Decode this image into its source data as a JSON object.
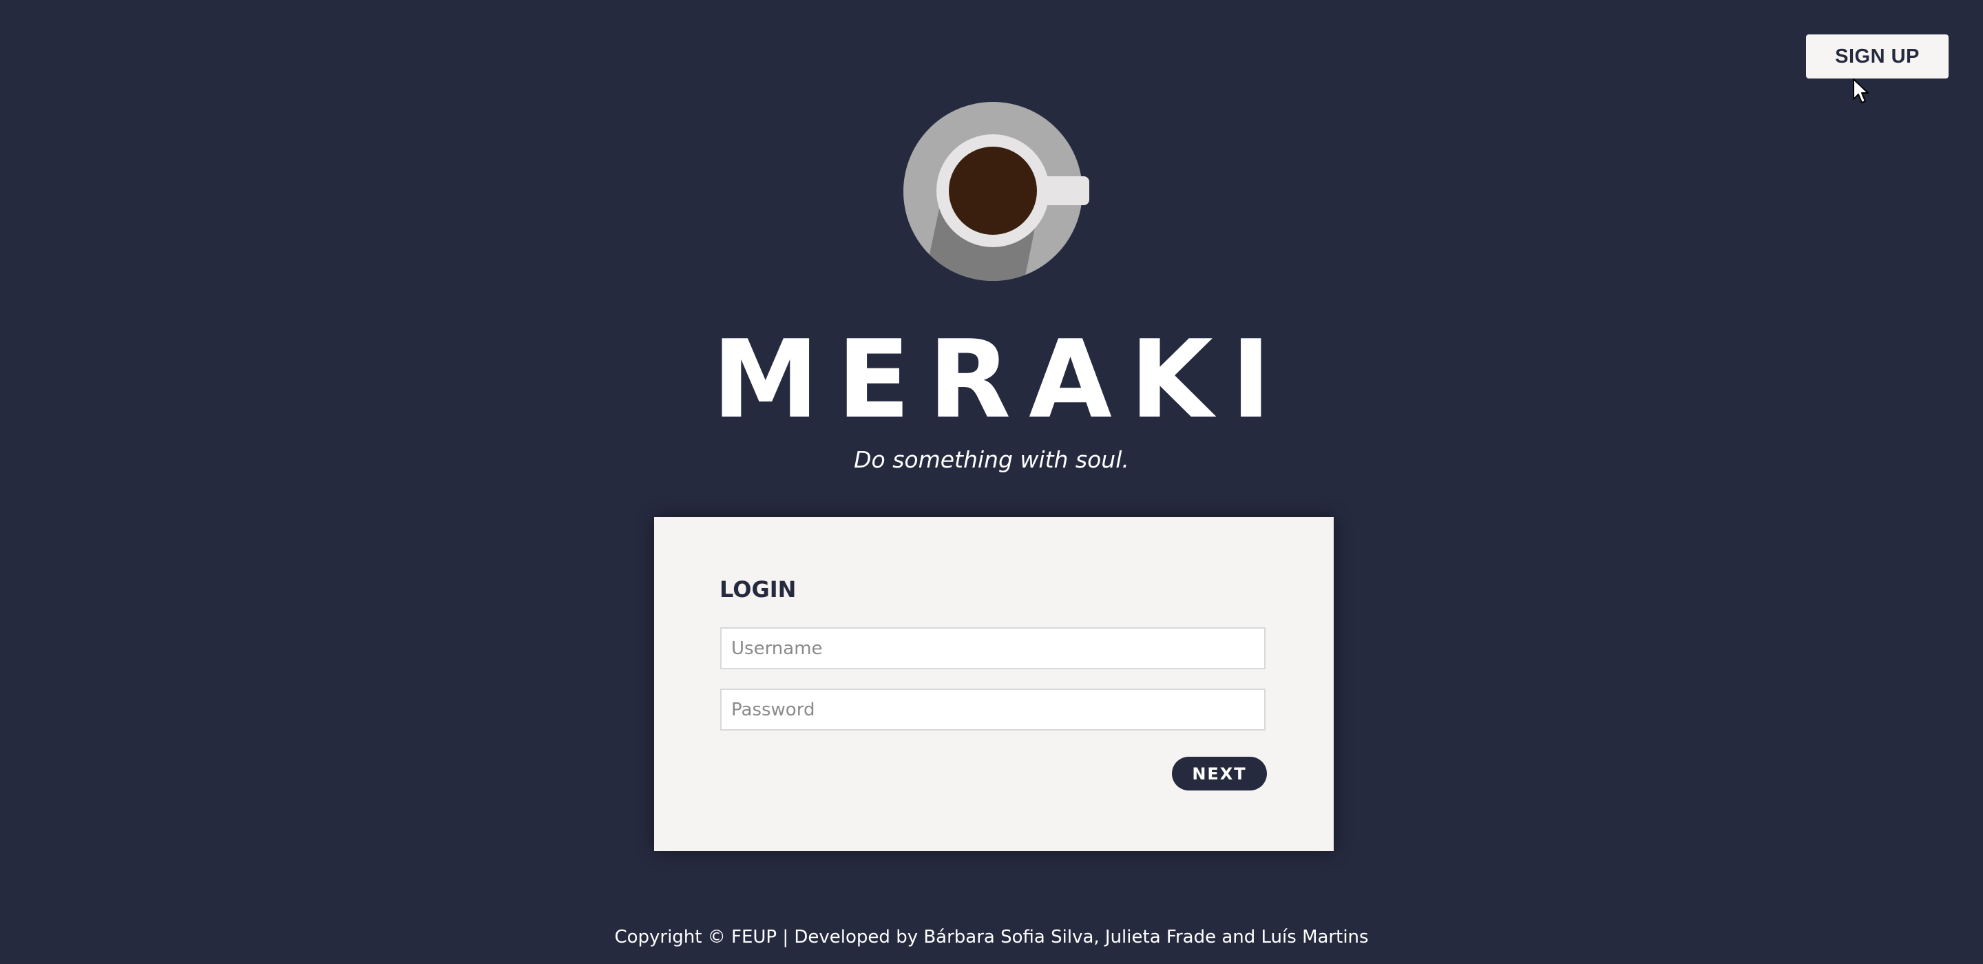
{
  "header": {
    "signup_label": "SIGN UP"
  },
  "brand": {
    "title": "MERAKI",
    "tagline": "Do something with soul.",
    "logo_icon": "coffee-cup-logo-icon"
  },
  "login": {
    "heading": "LOGIN",
    "username_placeholder": "Username",
    "username_value": "",
    "password_placeholder": "Password",
    "password_value": "",
    "next_label": "NEXT"
  },
  "footer": {
    "text": "Copyright © FEUP | Developed by Bárbara Sofia Silva, Julieta Frade and Luís Martins"
  },
  "colors": {
    "background": "#262a3f",
    "card": "#f5f4f2",
    "accent": "#262a3f",
    "text_light": "#ffffff"
  }
}
